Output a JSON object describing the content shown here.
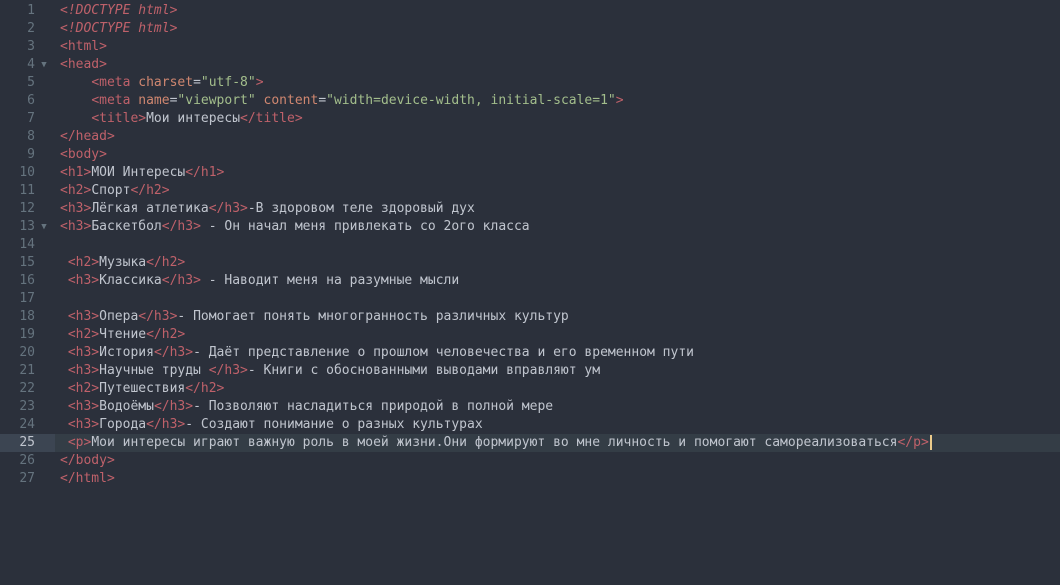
{
  "editor": {
    "active_line": 25,
    "lines": [
      {
        "n": "1",
        "fold": "",
        "tokens": [
          [
            "t-doc",
            "<!DOCTYPE html>"
          ]
        ]
      },
      {
        "n": "2",
        "fold": "",
        "tokens": [
          [
            "t-doc",
            "<!DOCTYPE html>"
          ]
        ]
      },
      {
        "n": "3",
        "fold": "",
        "tokens": [
          [
            "t-tag",
            "<html>"
          ]
        ]
      },
      {
        "n": "4",
        "fold": "▼",
        "tokens": [
          [
            "t-tag",
            "<head>"
          ]
        ]
      },
      {
        "n": "5",
        "fold": "",
        "tokens": [
          [
            "t-txt",
            "    "
          ],
          [
            "t-tag",
            "<meta "
          ],
          [
            "t-attr",
            "charset"
          ],
          [
            "t-txt",
            "="
          ],
          [
            "t-str",
            "\"utf-8\""
          ],
          [
            "t-tag",
            ">"
          ]
        ]
      },
      {
        "n": "6",
        "fold": "",
        "tokens": [
          [
            "t-txt",
            "    "
          ],
          [
            "t-tag",
            "<meta "
          ],
          [
            "t-attr",
            "name"
          ],
          [
            "t-txt",
            "="
          ],
          [
            "t-str",
            "\"viewport\""
          ],
          [
            "t-txt",
            " "
          ],
          [
            "t-attr",
            "content"
          ],
          [
            "t-txt",
            "="
          ],
          [
            "t-str",
            "\"width=device-width, initial-scale=1\""
          ],
          [
            "t-tag",
            ">"
          ]
        ]
      },
      {
        "n": "7",
        "fold": "",
        "tokens": [
          [
            "t-txt",
            "    "
          ],
          [
            "t-tag",
            "<title>"
          ],
          [
            "t-txt",
            "Мои интересы"
          ],
          [
            "t-tag",
            "</title>"
          ]
        ]
      },
      {
        "n": "8",
        "fold": "",
        "tokens": [
          [
            "t-tag",
            "</head>"
          ]
        ]
      },
      {
        "n": "9",
        "fold": "",
        "tokens": [
          [
            "t-tag",
            "<body>"
          ]
        ]
      },
      {
        "n": "10",
        "fold": "",
        "tokens": [
          [
            "t-tag",
            "<h1>"
          ],
          [
            "t-txt",
            "МОИ Интересы"
          ],
          [
            "t-tag",
            "</h1>"
          ]
        ]
      },
      {
        "n": "11",
        "fold": "",
        "tokens": [
          [
            "t-tag",
            "<h2>"
          ],
          [
            "t-txt",
            "Спорт"
          ],
          [
            "t-tag",
            "</h2>"
          ]
        ]
      },
      {
        "n": "12",
        "fold": "",
        "tokens": [
          [
            "t-tag",
            "<h3>"
          ],
          [
            "t-txt",
            "Лёгкая атлетика"
          ],
          [
            "t-tag",
            "</h3>"
          ],
          [
            "t-txt",
            "-В здоровом теле здоровый дух"
          ]
        ]
      },
      {
        "n": "13",
        "fold": "▼",
        "tokens": [
          [
            "t-tag",
            "<h3>"
          ],
          [
            "t-txt",
            "Баскетбол"
          ],
          [
            "t-tag",
            "</h3>"
          ],
          [
            "t-txt",
            " - Он начал меня привлекать со 2ого класса"
          ]
        ]
      },
      {
        "n": "14",
        "fold": "",
        "tokens": []
      },
      {
        "n": "15",
        "fold": "",
        "tokens": [
          [
            "t-txt",
            " "
          ],
          [
            "t-tag",
            "<h2>"
          ],
          [
            "t-txt",
            "Музыка"
          ],
          [
            "t-tag",
            "</h2>"
          ]
        ]
      },
      {
        "n": "16",
        "fold": "",
        "tokens": [
          [
            "t-txt",
            " "
          ],
          [
            "t-tag",
            "<h3>"
          ],
          [
            "t-txt",
            "Классика"
          ],
          [
            "t-tag",
            "</h3>"
          ],
          [
            "t-txt",
            " - Наводит меня на разумные мысли"
          ]
        ]
      },
      {
        "n": "17",
        "fold": "",
        "tokens": []
      },
      {
        "n": "18",
        "fold": "",
        "tokens": [
          [
            "t-txt",
            " "
          ],
          [
            "t-tag",
            "<h3>"
          ],
          [
            "t-txt",
            "Опера"
          ],
          [
            "t-tag",
            "</h3>"
          ],
          [
            "t-txt",
            "- Помогает понять многогранность различных культур"
          ]
        ]
      },
      {
        "n": "19",
        "fold": "",
        "tokens": [
          [
            "t-txt",
            " "
          ],
          [
            "t-tag",
            "<h2>"
          ],
          [
            "t-txt",
            "Чтение"
          ],
          [
            "t-tag",
            "</h2>"
          ]
        ]
      },
      {
        "n": "20",
        "fold": "",
        "tokens": [
          [
            "t-txt",
            " "
          ],
          [
            "t-tag",
            "<h3>"
          ],
          [
            "t-txt",
            "История"
          ],
          [
            "t-tag",
            "</h3>"
          ],
          [
            "t-txt",
            "- Даёт представление о прошлом человечества и его временном пути"
          ]
        ]
      },
      {
        "n": "21",
        "fold": "",
        "tokens": [
          [
            "t-txt",
            " "
          ],
          [
            "t-tag",
            "<h3>"
          ],
          [
            "t-txt",
            "Научные труды "
          ],
          [
            "t-tag",
            "</h3>"
          ],
          [
            "t-txt",
            "- Книги с обоснованными выводами вправляют ум"
          ]
        ]
      },
      {
        "n": "22",
        "fold": "",
        "tokens": [
          [
            "t-txt",
            " "
          ],
          [
            "t-tag",
            "<h2>"
          ],
          [
            "t-txt",
            "Путешествия"
          ],
          [
            "t-tag",
            "</h2>"
          ]
        ]
      },
      {
        "n": "23",
        "fold": "",
        "tokens": [
          [
            "t-txt",
            " "
          ],
          [
            "t-tag",
            "<h3>"
          ],
          [
            "t-txt",
            "Водоёмы"
          ],
          [
            "t-tag",
            "</h3>"
          ],
          [
            "t-txt",
            "- Позволяют насладиться природой в полной мере"
          ]
        ]
      },
      {
        "n": "24",
        "fold": "",
        "tokens": [
          [
            "t-txt",
            " "
          ],
          [
            "t-tag",
            "<h3>"
          ],
          [
            "t-txt",
            "Города"
          ],
          [
            "t-tag",
            "</h3>"
          ],
          [
            "t-txt",
            "- Создают понимание о разных культурах"
          ]
        ]
      },
      {
        "n": "25",
        "fold": "",
        "tokens": [
          [
            "t-txt",
            " "
          ],
          [
            "t-tag",
            "<p>"
          ],
          [
            "t-txt",
            "Мои интересы играют важную роль в моей жизни.Они формируют во мне личность и помогают самореализоваться"
          ],
          [
            "t-tag",
            "</p>"
          ]
        ]
      },
      {
        "n": "26",
        "fold": "",
        "tokens": [
          [
            "t-tag",
            "</body>"
          ]
        ]
      },
      {
        "n": "27",
        "fold": "",
        "tokens": [
          [
            "t-tag",
            "</html>"
          ]
        ]
      }
    ]
  }
}
